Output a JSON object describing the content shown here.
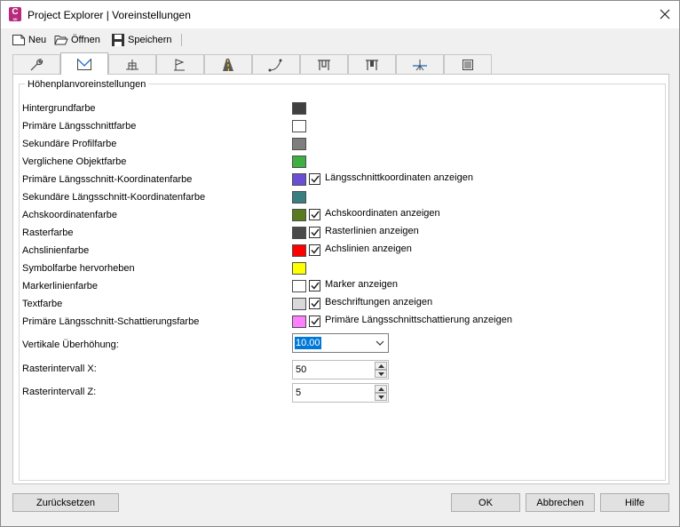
{
  "window": {
    "title": "Project Explorer | Voreinstellungen",
    "app_icon_letter": "C",
    "app_icon_sub": "3D"
  },
  "toolbar": {
    "new_label": "Neu",
    "open_label": "Öffnen",
    "save_label": "Speichern"
  },
  "tabs": [
    {
      "icon": "wrench-icon"
    },
    {
      "icon": "profile-view-icon",
      "active": true
    },
    {
      "icon": "cross-section-icon"
    },
    {
      "icon": "flag-icon"
    },
    {
      "icon": "road-icon"
    },
    {
      "icon": "alignment-curve-icon"
    },
    {
      "icon": "structure-icon"
    },
    {
      "icon": "structure-alt-icon"
    },
    {
      "icon": "survey-icon"
    },
    {
      "icon": "table-icon"
    }
  ],
  "group": {
    "title": "Höhenplanvoreinstellungen"
  },
  "settings": [
    {
      "label": "Hintergrundfarbe",
      "color": "#404040"
    },
    {
      "label": "Primäre Längsschnittfarbe",
      "color": "#ffffff"
    },
    {
      "label": "Sekundäre Profilfarbe",
      "color": "#7f7f7f"
    },
    {
      "label": "Verglichene Objektfarbe",
      "color": "#3cb043"
    },
    {
      "label": "Primäre Längsschnitt-Koordinatenfarbe",
      "color": "#6a4fd4",
      "checkbox": "Längsschnittkoordinaten anzeigen"
    },
    {
      "label": "Sekundäre Längsschnitt-Koordinatenfarbe",
      "color": "#3a7e80"
    },
    {
      "label": "Achskoordinatenfarbe",
      "color": "#5a7a1e",
      "checkbox": "Achskoordinaten anzeigen"
    },
    {
      "label": "Rasterfarbe",
      "color": "#4a4a4a",
      "checkbox": "Rasterlinien anzeigen"
    },
    {
      "label": "Achslinienfarbe",
      "color": "#ff0000",
      "checkbox": "Achslinien anzeigen"
    },
    {
      "label": "Symbolfarbe hervorheben",
      "color": "#ffff00"
    },
    {
      "label": "Markerlinienfarbe",
      "color": "#ffffff",
      "checkbox": "Marker anzeigen"
    },
    {
      "label": "Textfarbe",
      "color": "#d9d9d9",
      "checkbox": "Beschriftungen anzeigen"
    },
    {
      "label": "Primäre Längsschnitt-Schattierungsfarbe",
      "color": "#ff80ff",
      "checkbox": "Primäre Längsschnittschattierung anzeigen"
    }
  ],
  "fields": {
    "exaggeration_label": "Vertikale Überhöhung:",
    "exaggeration_value": "10.00",
    "grid_x_label": "Rasterintervall X:",
    "grid_x_value": "50",
    "grid_z_label": "Rasterintervall Z:",
    "grid_z_value": "5"
  },
  "buttons": {
    "reset": "Zurücksetzen",
    "ok": "OK",
    "cancel": "Abbrechen",
    "help": "Hilfe"
  }
}
